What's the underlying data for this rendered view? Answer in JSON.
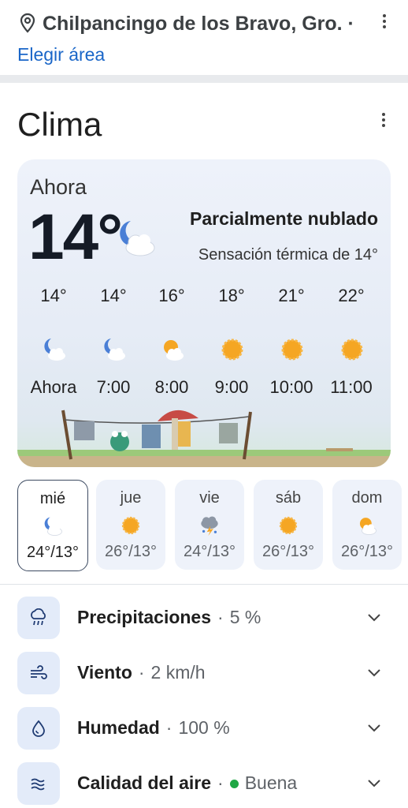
{
  "location": {
    "title": "Chilpancingo de los Bravo, Gro. ·",
    "link": "Elegir área"
  },
  "header": {
    "title": "Clima"
  },
  "current": {
    "label": "Ahora",
    "temp": "14°",
    "icon": "night-partly-cloudy-icon",
    "condition": "Parcialmente nublado",
    "feels_like": "Sensación térmica de 14°"
  },
  "hourly": [
    {
      "temp": "14°",
      "time": "Ahora",
      "icon": "night-partly-cloudy-icon"
    },
    {
      "temp": "14°",
      "time": "7:00",
      "icon": "night-partly-cloudy-icon"
    },
    {
      "temp": "16°",
      "time": "8:00",
      "icon": "sun-cloud-icon"
    },
    {
      "temp": "18°",
      "time": "9:00",
      "icon": "sun-icon"
    },
    {
      "temp": "21°",
      "time": "10:00",
      "icon": "sun-icon"
    },
    {
      "temp": "22°",
      "time": "11:00",
      "icon": "sun-icon"
    }
  ],
  "daily": [
    {
      "day": "mié",
      "range": "24°/13°",
      "icon": "night-partly-cloudy-icon",
      "selected": true
    },
    {
      "day": "jue",
      "range": "26°/13°",
      "icon": "sun-icon"
    },
    {
      "day": "vie",
      "range": "24°/13°",
      "icon": "thunderstorm-icon"
    },
    {
      "day": "sáb",
      "range": "26°/13°",
      "icon": "sun-icon"
    },
    {
      "day": "dom",
      "range": "26°/13°",
      "icon": "sun-cloud-icon"
    }
  ],
  "details": [
    {
      "label": "Precipitaciones",
      "sep": "·",
      "value": "5 %",
      "icon": "rain-cloud-icon"
    },
    {
      "label": "Viento",
      "sep": "·",
      "value": "2 km/h",
      "icon": "wind-icon"
    },
    {
      "label": "Humedad",
      "sep": "·",
      "value": "100 %",
      "icon": "droplet-icon"
    },
    {
      "label": "Calidad del aire",
      "sep": "·",
      "value": "Buena",
      "icon": "air-quality-icon",
      "status_color": "#1fa744"
    }
  ],
  "colors": {
    "accent": "#1a66c8",
    "sun": "#f5a623",
    "moon": "#4a7fd6"
  }
}
